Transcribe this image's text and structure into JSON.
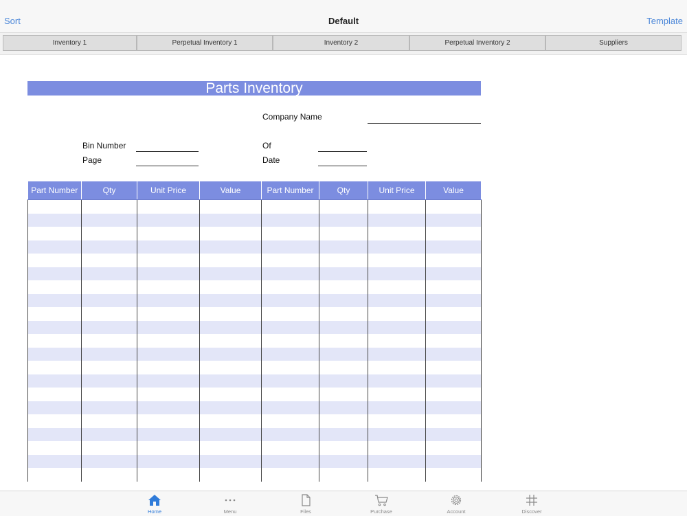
{
  "navbar": {
    "left_label": "Sort",
    "title": "Default",
    "right_label": "Template"
  },
  "tabs": [
    {
      "label": "Inventory 1"
    },
    {
      "label": "Perpetual Inventory 1"
    },
    {
      "label": "Inventory 2"
    },
    {
      "label": "Perpetual Inventory 2"
    },
    {
      "label": "Suppliers"
    }
  ],
  "sheet": {
    "title": "Parts Inventory",
    "company_label": "Company Name",
    "bin_label": "Bin Number",
    "of_label": "Of",
    "page_label": "Page",
    "date_label": "Date",
    "columns": [
      "Part Number",
      "Qty",
      "Unit Price",
      "Value",
      "Part Number",
      "Qty",
      "Unit Price",
      "Value"
    ],
    "header_color": "#7c8de0",
    "stripe_color": "#e3e6f8"
  },
  "bottom_tabs": [
    {
      "label": "Home",
      "icon": "home-icon",
      "active": true
    },
    {
      "label": "Menu",
      "icon": "ellipsis-icon",
      "active": false
    },
    {
      "label": "Files",
      "icon": "file-icon",
      "active": false
    },
    {
      "label": "Purchase",
      "icon": "cart-icon",
      "active": false
    },
    {
      "label": "Account",
      "icon": "gear-icon",
      "active": false
    },
    {
      "label": "Discover",
      "icon": "grid-icon",
      "active": false
    }
  ],
  "accent_color": "#2f7bd9"
}
